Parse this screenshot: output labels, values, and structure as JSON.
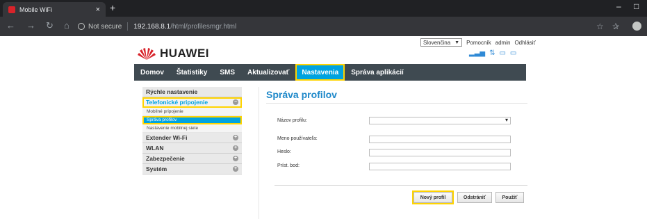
{
  "browser": {
    "tab_title": "Mobile WiFi",
    "tab_close": "×",
    "new_tab": "+",
    "not_secure": "Not secure",
    "url_host": "192.168.8.1",
    "url_path": "/html/profilesmgr.html",
    "window_min": "–",
    "window_max": "□"
  },
  "header": {
    "language": "Slovenčina",
    "help": "Pomocník",
    "user": "admin",
    "logout": "Odhlásiť",
    "logo_text": "HUAWEI"
  },
  "menu": [
    {
      "label": "Domov"
    },
    {
      "label": "Štatistiky"
    },
    {
      "label": "SMS"
    },
    {
      "label": "Aktualizovať"
    },
    {
      "label": "Nastavenia"
    },
    {
      "label": "Správa aplikácií"
    }
  ],
  "sidebar": {
    "quick_setup": "Rýchle nastavenie",
    "dialup": "Telefonické pripojenie",
    "dialup_items": [
      "Mobilné pripojenie",
      "Správa profilov",
      "Nastavenie mobilnej siete"
    ],
    "extender": "Extender Wi-Fi",
    "wlan": "WLAN",
    "security": "Zabezpečenie",
    "system": "Systém"
  },
  "content": {
    "title": "Správa profilov",
    "profile_name_label": "Názov profilu:",
    "username_label": "Meno používateľa:",
    "password_label": "Heslo:",
    "apn_label": "Príst. bod:",
    "profile_name_value": "",
    "username_value": "",
    "password_value": "",
    "apn_value": ""
  },
  "buttons": {
    "new_profile": "Nový profil",
    "delete": "Odstrániť",
    "apply": "Použiť"
  },
  "colors": {
    "accent": "#00a3e0",
    "highlight": "#ffd400",
    "menubar": "#3f4a51",
    "title": "#1e88c9"
  }
}
